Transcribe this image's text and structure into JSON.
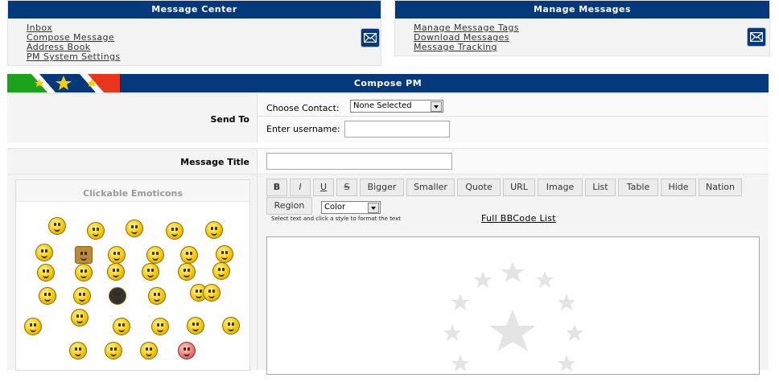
{
  "message_center": {
    "title": "Message Center",
    "links": [
      "Inbox",
      "Compose Message",
      "Address Book",
      "PM System Settings"
    ]
  },
  "manage_messages": {
    "title": "Manage Messages",
    "links": [
      "Manage Message Tags",
      "Download Messages",
      "Message Tracking"
    ]
  },
  "compose": {
    "title": "Compose PM",
    "send_to_label": "Send To",
    "choose_contact_label": "Choose Contact:",
    "contact_selected": "None Selected",
    "enter_username_label": "Enter username:",
    "message_title_label": "Message Title",
    "emoticons_title": "Clickable Emoticons",
    "toolbar": [
      "B",
      "I",
      "U",
      "S",
      "Bigger",
      "Smaller",
      "Quote",
      "URL",
      "Image",
      "List",
      "Table",
      "Hide",
      "Nation",
      "Region"
    ],
    "color_select": "Color",
    "hint": "Select text and click a style to format the text",
    "bbcode_link": "Full BBCode List"
  },
  "colors": {
    "header_blue": "#05397c",
    "panel_bg": "#f3f3f3",
    "emoticon_yellow": "#f5c800"
  },
  "icons": [
    "mail-icon",
    "nation-flag-icon",
    "star-watermark-icon",
    "emoticon-icon"
  ]
}
